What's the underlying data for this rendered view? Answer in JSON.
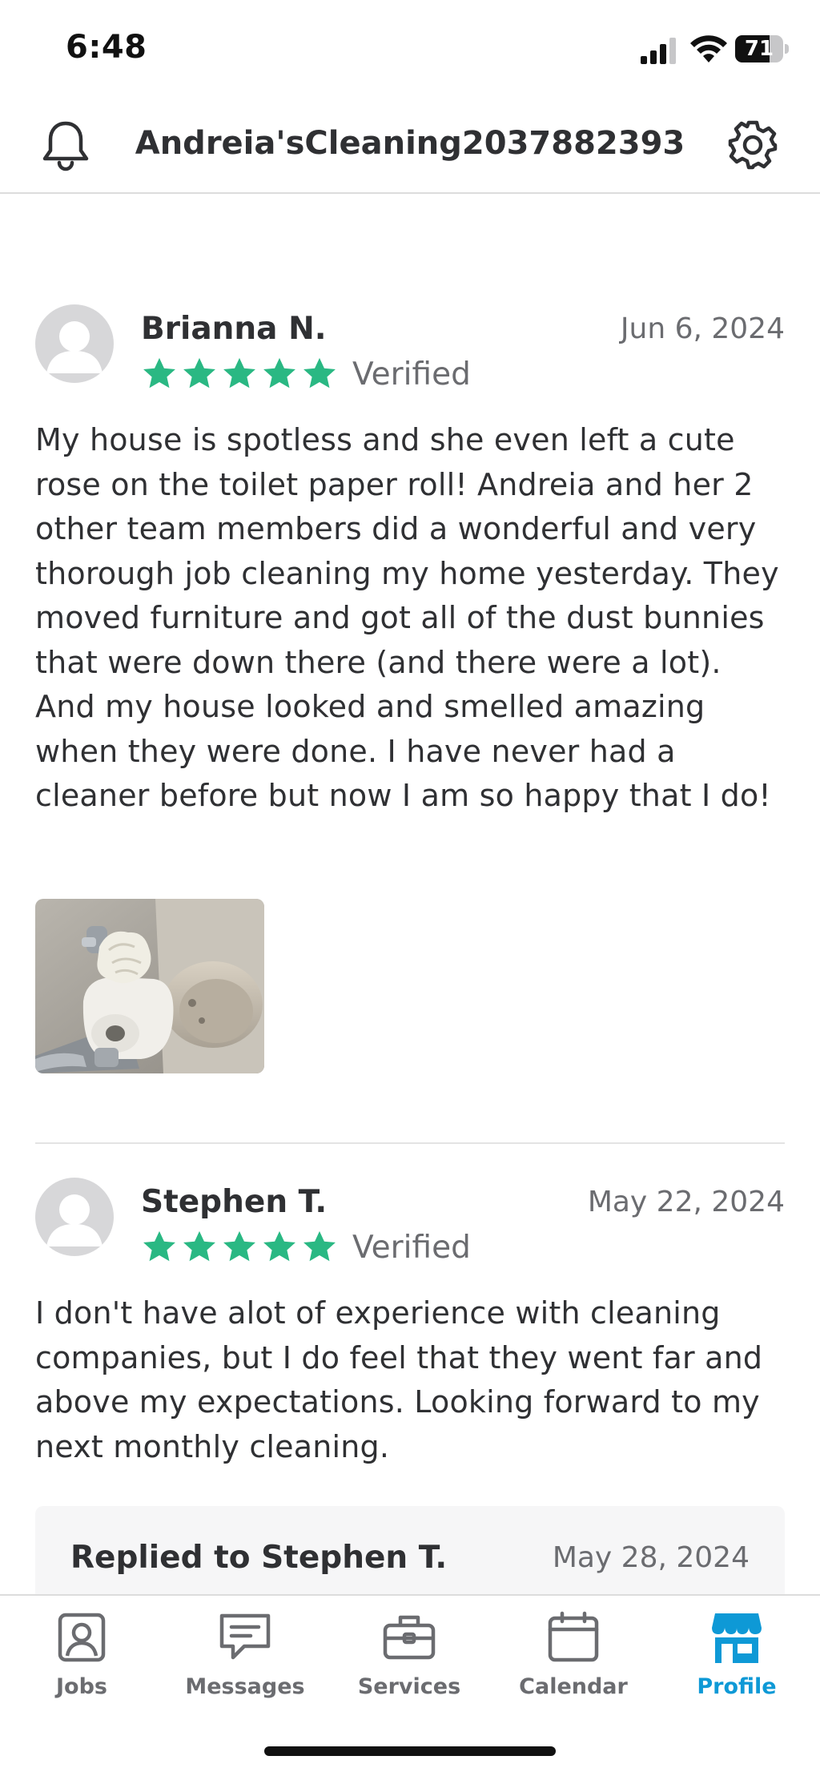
{
  "status_bar": {
    "time": "6:48",
    "battery": "71",
    "battery_level": 0.71
  },
  "header": {
    "title": "Andreia'sCleaning2037882393",
    "left_icon": "bell-icon",
    "right_icon": "gear-icon"
  },
  "reviews": [
    {
      "name": "Brianna N.",
      "date": "Jun 6, 2024",
      "rating": 5,
      "verified": "Verified",
      "text": "My house is spotless and she even left a cute rose on the toilet paper roll! Andreia and her 2 other team members did a wonderful and very thorough job cleaning my home yesterday. They moved furniture and got all of the dust bunnies that were down there (and there were a lot). And my house looked and smelled amazing when they were done. I have never had a cleaner before but now I am so happy that I do!"
    },
    {
      "name": "Stephen T.",
      "date": "May 22, 2024",
      "rating": 5,
      "verified": "Verified",
      "text": "I don't have alot of experience with cleaning companies, but I do feel that they went far and above my expectations.  Looking forward to my next monthly cleaning.",
      "reply": {
        "title": "Replied to Stephen T.",
        "date": "May 28, 2024"
      }
    }
  ],
  "tabs": [
    {
      "label": "Jobs",
      "icon": "jobs-icon",
      "active": false
    },
    {
      "label": "Messages",
      "icon": "messages-icon",
      "active": false
    },
    {
      "label": "Services",
      "icon": "services-icon",
      "active": false
    },
    {
      "label": "Calendar",
      "icon": "calendar-icon",
      "active": false
    },
    {
      "label": "Profile",
      "icon": "profile-icon",
      "active": true
    }
  ],
  "colors": {
    "star": "#2ab883",
    "accent": "#0e99d6",
    "text": "#2f3033",
    "muted": "#6b6c70"
  }
}
